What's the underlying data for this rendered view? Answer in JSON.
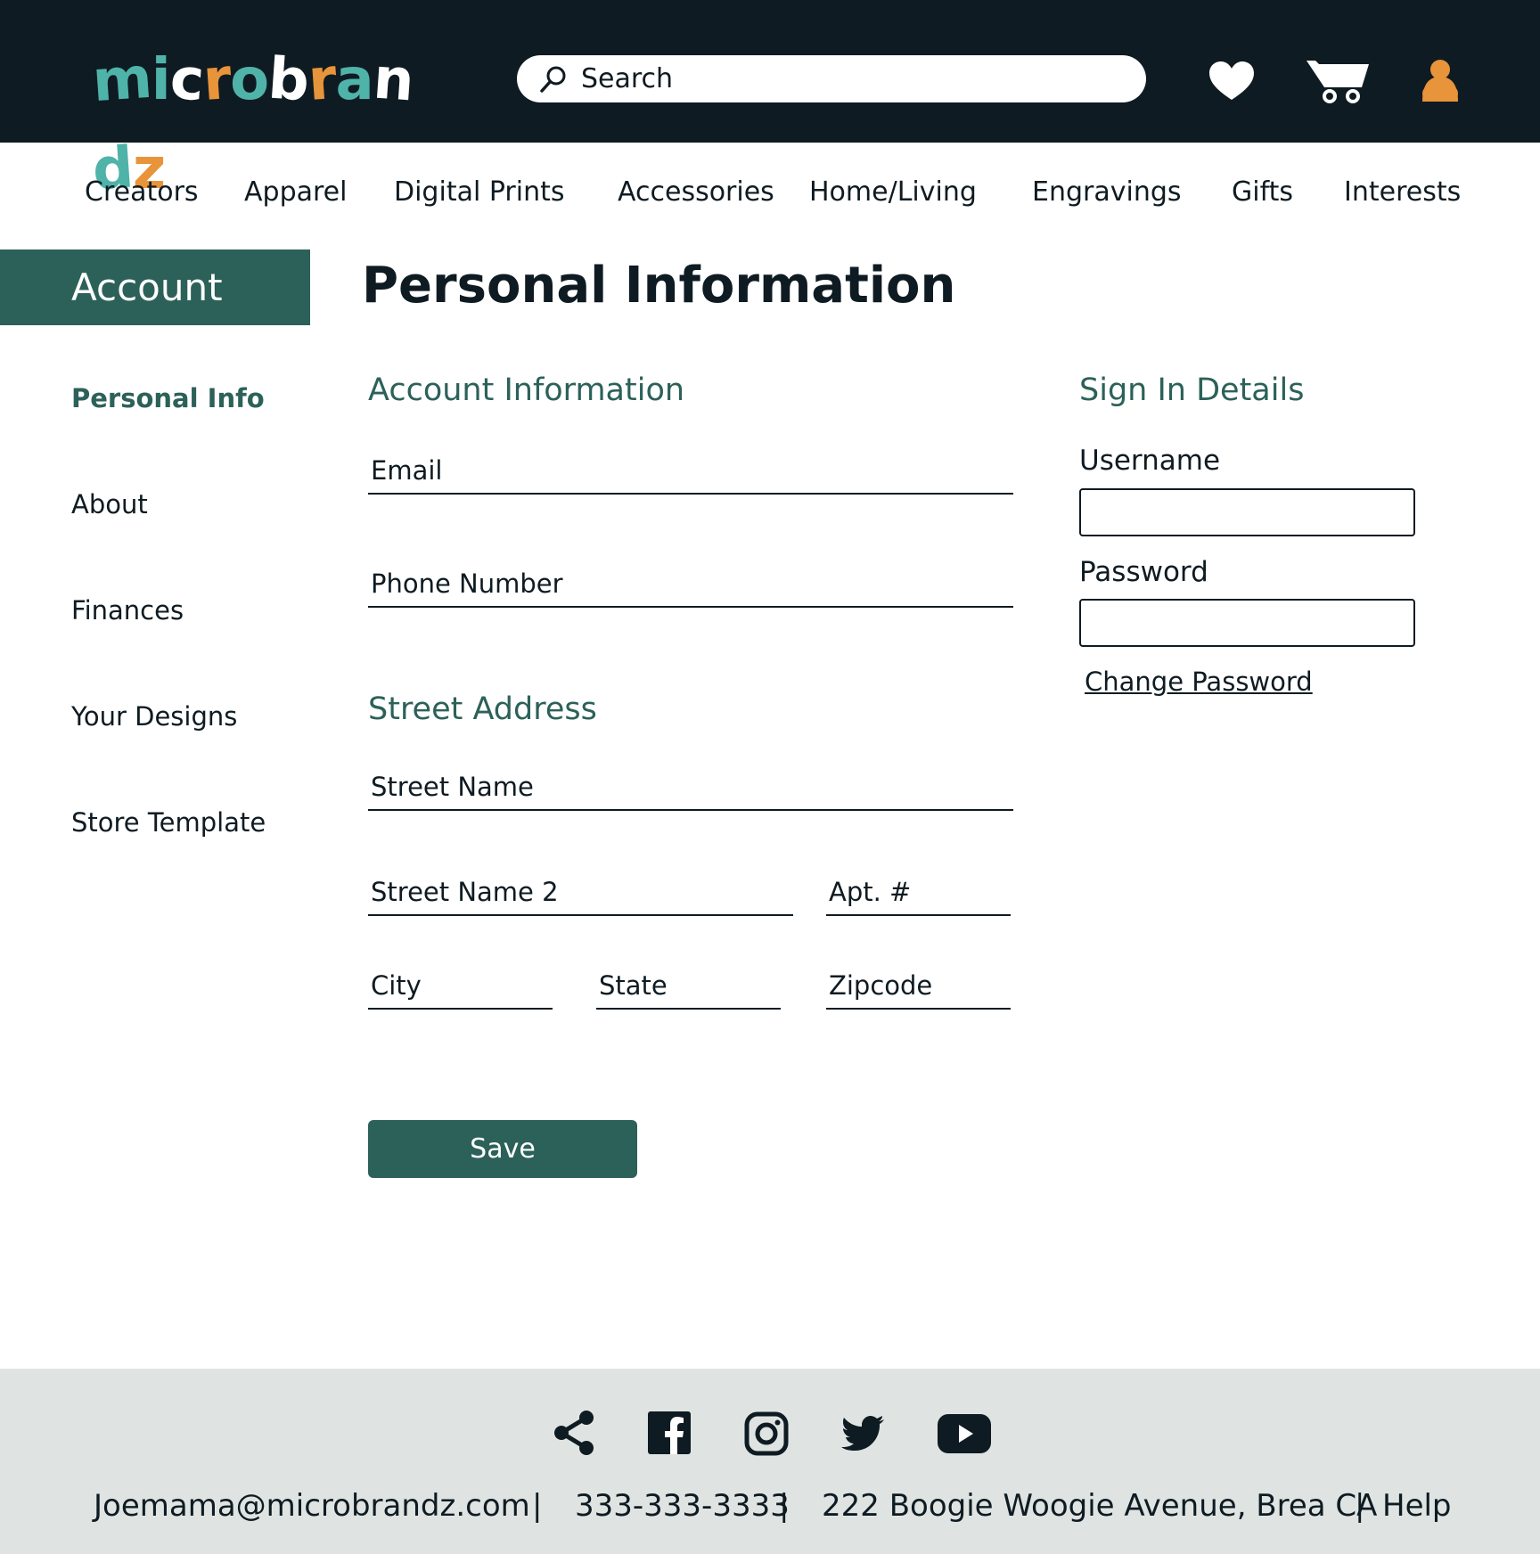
{
  "header": {
    "logo_letters": [
      {
        "ch": "m",
        "color": "#4fb3a9"
      },
      {
        "ch": "i",
        "color": "#4fb3a9"
      },
      {
        "ch": "c",
        "color": "#ffffff"
      },
      {
        "ch": "r",
        "color": "#e8943a"
      },
      {
        "ch": "o",
        "color": "#4fb3a9"
      },
      {
        "ch": "b",
        "color": "#ffffff"
      },
      {
        "ch": "r",
        "color": "#e8943a"
      },
      {
        "ch": "a",
        "color": "#4fb3a9"
      },
      {
        "ch": "n",
        "color": "#ffffff"
      },
      {
        "ch": "d",
        "color": "#4fb3a9"
      },
      {
        "ch": "z",
        "color": "#e8943a"
      },
      {
        "ch": ".",
        "color": "#ffffff"
      }
    ],
    "logo_text": "microbrandz.",
    "search_placeholder": "Search",
    "icons": [
      "search-icon",
      "heart-icon",
      "cart-icon",
      "user-icon"
    ]
  },
  "categories": [
    "Creators",
    "Apparel",
    "Digital Prints",
    "Accessories",
    "Home/Living",
    "Engravings",
    "Gifts",
    "Interests"
  ],
  "sidebar": {
    "heading": "Account",
    "items": [
      {
        "label": "Personal Info",
        "active": true
      },
      {
        "label": "About",
        "active": false
      },
      {
        "label": "Finances",
        "active": false
      },
      {
        "label": "Your Designs",
        "active": false
      },
      {
        "label": "Store Template",
        "active": false
      }
    ]
  },
  "main": {
    "title": "Personal Information",
    "account_info": {
      "heading": "Account Information",
      "email_placeholder": "Email",
      "phone_placeholder": "Phone Number"
    },
    "address": {
      "heading": "Street Address",
      "street_placeholder": "Street Name",
      "street2_placeholder": "Street Name 2",
      "apt_placeholder": "Apt. #",
      "city_placeholder": "City",
      "state_placeholder": "State",
      "zip_placeholder": "Zipcode"
    },
    "sign_in": {
      "heading": "Sign In Details",
      "username_label": "Username",
      "password_label": "Password",
      "change_password": "Change Password"
    },
    "save_label": "Save"
  },
  "footer": {
    "social_icons": [
      "share-icon",
      "facebook-icon",
      "instagram-icon",
      "twitter-icon",
      "youtube-icon"
    ],
    "email": "Joemama@microbrandz.com",
    "phone": "333-333-3333",
    "address": "222 Boogie Woogie Avenue, Brea CA",
    "help": "Help",
    "separator": "|"
  },
  "colors": {
    "header_bg": "#0f1b22",
    "accent_green": "#2c6159",
    "user_orange": "#e8943a",
    "footer_bg": "#dfe4e3"
  }
}
